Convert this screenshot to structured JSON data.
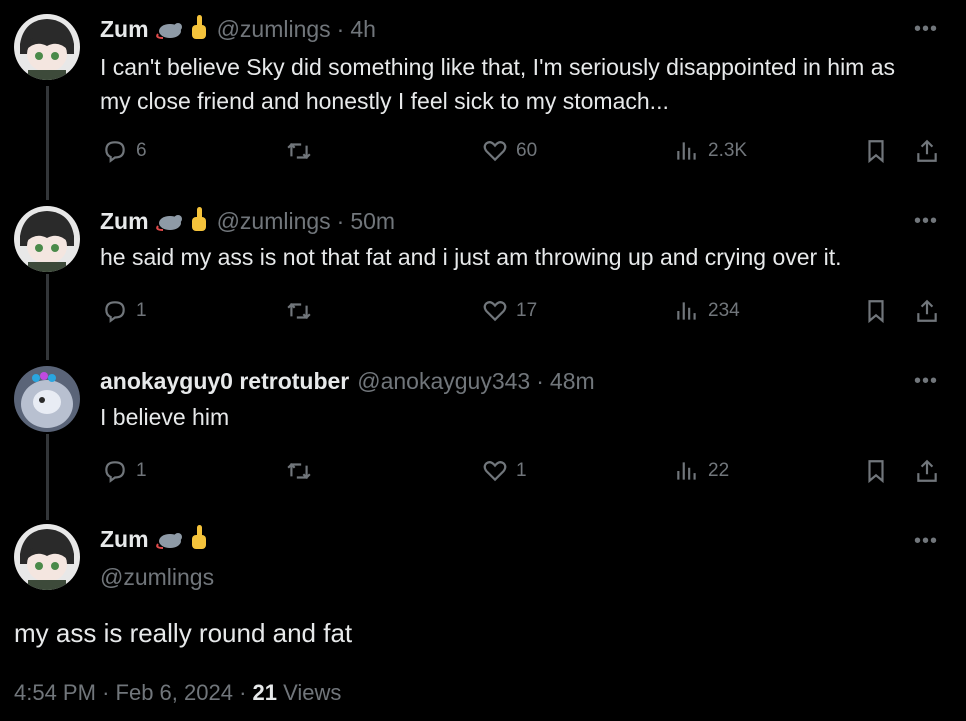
{
  "tweets": [
    {
      "name": "Zum",
      "handle": "@zumlings",
      "sep": "·",
      "time": "4h",
      "text": "I can't believe Sky did something like that, I'm seriously disappointed in him as my close friend and honestly I feel sick to my stomach...",
      "replies": "6",
      "retweets": "",
      "likes": "60",
      "views": "2.3K"
    },
    {
      "name": "Zum",
      "handle": "@zumlings",
      "sep": "·",
      "time": "50m",
      "text": "he said my ass is not that fat and i just am throwing up and crying over it.",
      "replies": "1",
      "retweets": "",
      "likes": "17",
      "views": "234"
    },
    {
      "name": "anokayguy0 retrotuber",
      "handle": "@anokayguy343",
      "sep": "·",
      "time": "48m",
      "text": "I believe him",
      "replies": "1",
      "retweets": "",
      "likes": "1",
      "views": "22"
    }
  ],
  "main": {
    "name": "Zum",
    "handle": "@zumlings",
    "text": "my ass is really round and fat",
    "time": "4:54 PM",
    "date": "Feb 6, 2024",
    "sep": "·",
    "views_count": "21",
    "views_label": "Views"
  },
  "icons": {
    "more": "more-icon",
    "reply": "reply-icon",
    "retweet": "retweet-icon",
    "like": "heart-icon",
    "views": "views-icon",
    "bookmark": "bookmark-icon",
    "share": "share-icon"
  },
  "colors": {
    "background": "#000000",
    "text": "#e7e9ea",
    "muted": "#71767b"
  }
}
